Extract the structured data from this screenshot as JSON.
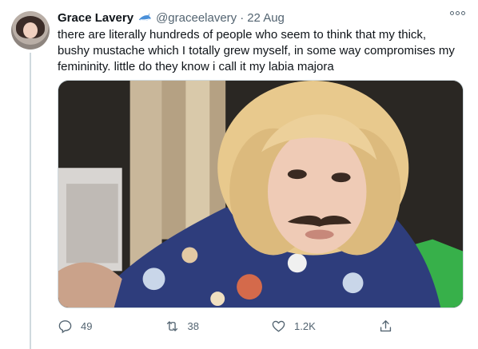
{
  "tweet": {
    "display_name": "Grace Lavery",
    "handle": "@graceelavery",
    "separator": "·",
    "date": "22 Aug",
    "text": "there are literally hundreds of people who seem to think that my thick, bushy mustache which I totally grew myself, in some way compromises my femininity. little do they know i call it my labia majora",
    "media_description": "photo",
    "verified_icon": "shark-emoji-icon",
    "accent": "#1d9bf0"
  },
  "actions": {
    "replies": "49",
    "retweets": "38",
    "likes": "1.2K"
  }
}
